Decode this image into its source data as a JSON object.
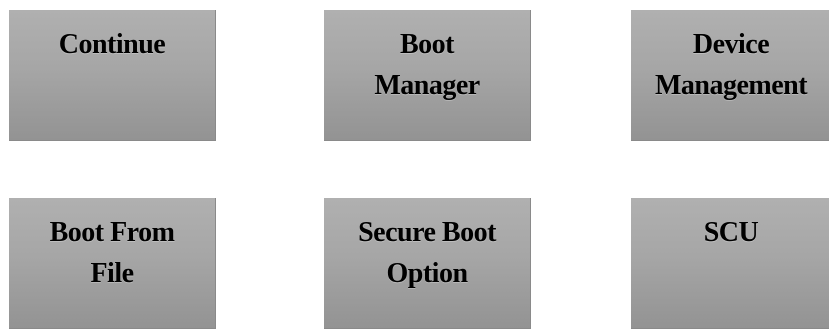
{
  "menu": {
    "items": [
      {
        "label": "Continue"
      },
      {
        "label": "Boot\nManager"
      },
      {
        "label": "Device\nManagement"
      },
      {
        "label": "Boot From\nFile"
      },
      {
        "label": "Secure Boot\nOption"
      },
      {
        "label": "SCU"
      }
    ]
  },
  "colors": {
    "tile_top": "#b0b0b0",
    "tile_bottom": "#939393",
    "text": "#000000",
    "background": "#ffffff"
  }
}
